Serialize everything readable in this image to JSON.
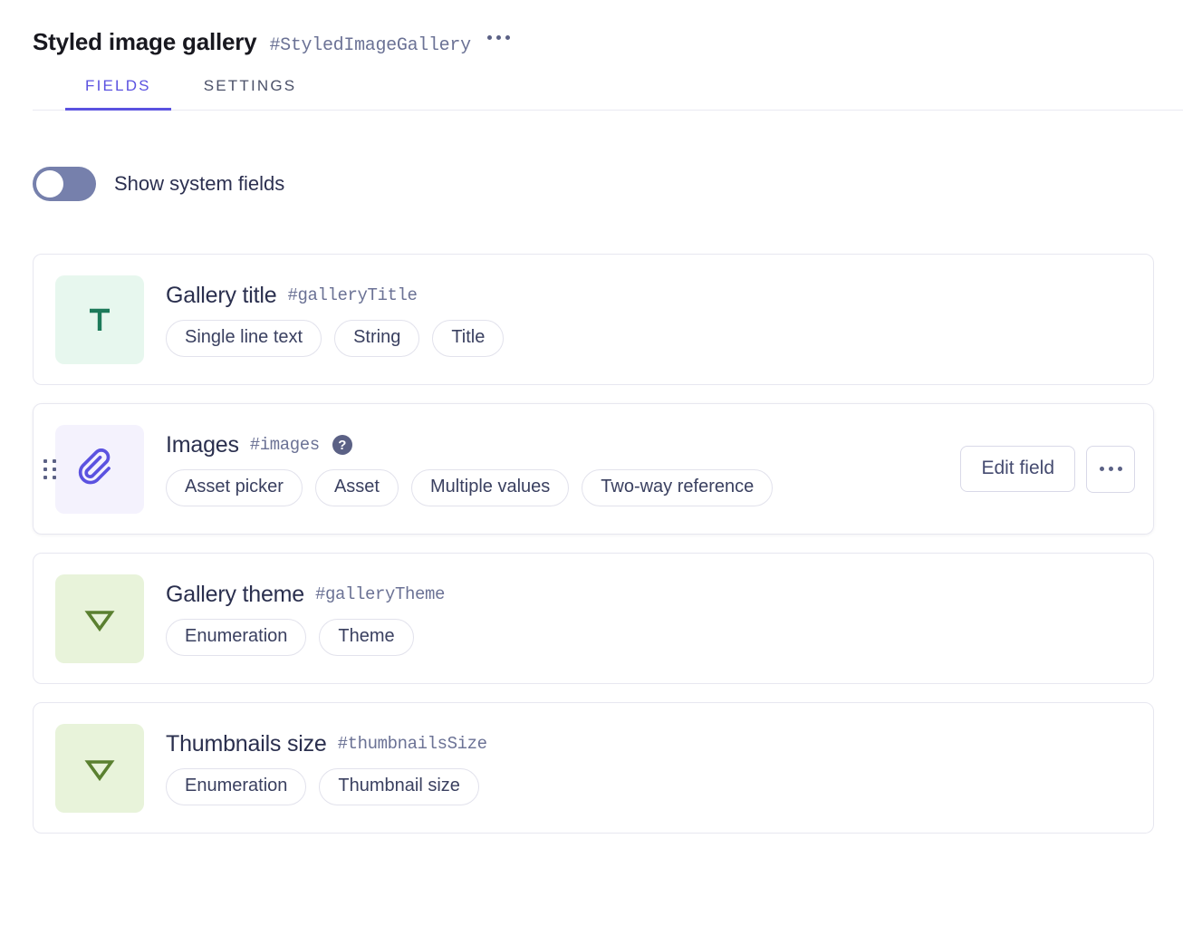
{
  "header": {
    "title": "Styled image gallery",
    "api_id": "#StyledImageGallery",
    "menu_icon": "ellipsis-icon"
  },
  "tabs": [
    {
      "label": "FIELDS",
      "active": true
    },
    {
      "label": "SETTINGS",
      "active": false
    }
  ],
  "toolbar": {
    "show_system_fields_label": "Show system fields",
    "show_system_fields_on": false
  },
  "colors": {
    "accent": "#5b52e0",
    "text_primary": "#2a2f4e",
    "text_muted": "#6b7295",
    "card_border": "#e7e7f0",
    "toggle_track": "#7680ac",
    "icon_text_bg": "#e7f7ee",
    "icon_text_fg": "#1d7a5a",
    "icon_asset_bg": "#f4f2fd",
    "icon_asset_fg": "#5b52e0",
    "icon_enum_bg": "#e8f3da",
    "icon_enum_fg": "#5a8030"
  },
  "fields": [
    {
      "name": "Gallery title",
      "api_id": "#galleryTitle",
      "icon": "text-field-icon",
      "icon_glyph": "T",
      "icon_style": "text",
      "has_help": false,
      "tags": [
        "Single line text",
        "String",
        "Title"
      ],
      "hovered": false,
      "actions": null
    },
    {
      "name": "Images",
      "api_id": "#images",
      "icon": "paperclip-icon",
      "icon_glyph": "",
      "icon_style": "asset",
      "has_help": true,
      "help_glyph": "?",
      "tags": [
        "Asset picker",
        "Asset",
        "Multiple values",
        "Two-way reference"
      ],
      "hovered": true,
      "actions": {
        "edit_label": "Edit field",
        "more_icon": "ellipsis-icon"
      }
    },
    {
      "name": "Gallery theme",
      "api_id": "#galleryTheme",
      "icon": "enumeration-icon",
      "icon_glyph": "",
      "icon_style": "enum",
      "has_help": false,
      "tags": [
        "Enumeration",
        "Theme"
      ],
      "hovered": false,
      "actions": null
    },
    {
      "name": "Thumbnails size",
      "api_id": "#thumbnailsSize",
      "icon": "enumeration-icon",
      "icon_glyph": "",
      "icon_style": "enum",
      "has_help": false,
      "tags": [
        "Enumeration",
        "Thumbnail size"
      ],
      "hovered": false,
      "actions": null
    }
  ]
}
